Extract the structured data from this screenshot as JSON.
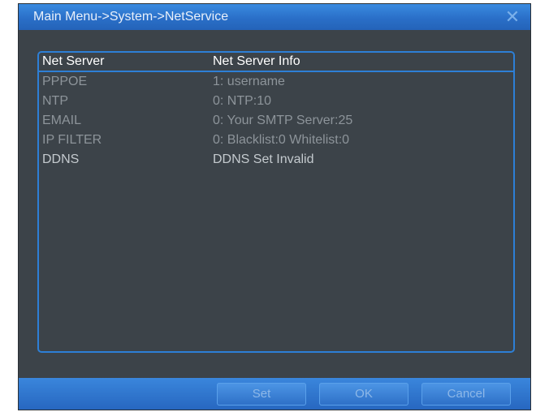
{
  "window": {
    "title": "Main Menu->System->NetService",
    "close_glyph": "✕",
    "close_icon": "close-icon"
  },
  "list": {
    "columns": [
      "Net Server",
      "Net Server Info"
    ],
    "rows": [
      {
        "server": "PPPOE",
        "info": "1: username",
        "style": "dim"
      },
      {
        "server": "NTP",
        "info": "0: NTP:10",
        "style": "dim"
      },
      {
        "server": "EMAIL",
        "info": "0: Your SMTP Server:25",
        "style": "dim"
      },
      {
        "server": "IP FILTER",
        "info": "0: Blacklist:0 Whitelist:0",
        "style": "dim"
      },
      {
        "server": "DDNS",
        "info": "DDNS Set Invalid",
        "style": "lit"
      }
    ]
  },
  "buttons": {
    "set": "Set",
    "ok": "OK",
    "cancel": "Cancel"
  },
  "colors": {
    "accent": "#2d7fd6",
    "background": "#3c4349",
    "titlebar": "#2a6fc8"
  }
}
